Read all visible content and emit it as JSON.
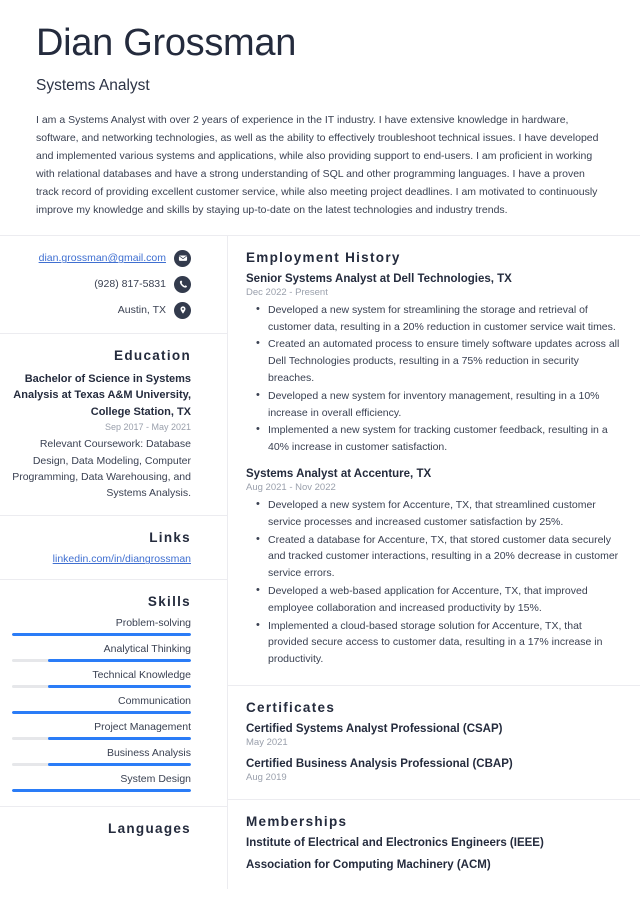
{
  "header": {
    "name": "Dian Grossman",
    "job_title": "Systems Analyst",
    "summary": "I am a Systems Analyst with over 2 years of experience in the IT industry. I have extensive knowledge in hardware, software, and networking technologies, as well as the ability to effectively troubleshoot technical issues. I have developed and implemented various systems and applications, while also providing support to end-users. I am proficient in working with relational databases and have a strong understanding of SQL and other programming languages. I have a proven track record of providing excellent customer service, while also meeting project deadlines. I am motivated to continuously improve my knowledge and skills by staying up-to-date on the latest technologies and industry trends."
  },
  "contact": {
    "email": "dian.grossman@gmail.com",
    "phone": "(928) 817-5831",
    "location": "Austin, TX",
    "email_icon": "envelope-icon",
    "phone_icon": "phone-icon",
    "location_icon": "map-pin-icon"
  },
  "education": {
    "heading": "Education",
    "degree": "Bachelor of Science in Systems Analysis at Texas A&M University, College Station, TX",
    "date": "Sep 2017 - May 2021",
    "description": "Relevant Coursework: Database Design, Data Modeling, Computer Programming, Data Warehousing, and Systems Analysis."
  },
  "links": {
    "heading": "Links",
    "items": [
      {
        "label": "linkedin.com/in/diangrossman"
      }
    ]
  },
  "skills": {
    "heading": "Skills",
    "items": [
      {
        "label": "Problem-solving",
        "level": 100
      },
      {
        "label": "Analytical Thinking",
        "level": 80
      },
      {
        "label": "Technical Knowledge",
        "level": 80
      },
      {
        "label": "Communication",
        "level": 100
      },
      {
        "label": "Project Management",
        "level": 80
      },
      {
        "label": "Business Analysis",
        "level": 80
      },
      {
        "label": "System Design",
        "level": 100
      }
    ]
  },
  "languages": {
    "heading": "Languages"
  },
  "employment": {
    "heading": "Employment History",
    "jobs": [
      {
        "title": "Senior Systems Analyst at Dell Technologies, TX",
        "date": "Dec 2022 - Present",
        "bullets": [
          "Developed a new system for streamlining the storage and retrieval of customer data, resulting in a 20% reduction in customer service wait times.",
          "Created an automated process to ensure timely software updates across all Dell Technologies products, resulting in a 75% reduction in security breaches.",
          "Developed a new system for inventory management, resulting in a 10% increase in overall efficiency.",
          "Implemented a new system for tracking customer feedback, resulting in a 40% increase in customer satisfaction."
        ]
      },
      {
        "title": "Systems Analyst at Accenture, TX",
        "date": "Aug 2021 - Nov 2022",
        "bullets": [
          "Developed a new system for Accenture, TX, that streamlined customer service processes and increased customer satisfaction by 25%.",
          "Created a database for Accenture, TX, that stored customer data securely and tracked customer interactions, resulting in a 20% decrease in customer service errors.",
          "Developed a web-based application for Accenture, TX, that improved employee collaboration and increased productivity by 15%.",
          "Implemented a cloud-based storage solution for Accenture, TX, that provided secure access to customer data, resulting in a 17% increase in productivity."
        ]
      }
    ]
  },
  "certificates": {
    "heading": "Certificates",
    "items": [
      {
        "title": "Certified Systems Analyst Professional (CSAP)",
        "date": "May 2021"
      },
      {
        "title": "Certified Business Analysis Professional (CBAP)",
        "date": "Aug 2019"
      }
    ]
  },
  "memberships": {
    "heading": "Memberships",
    "items": [
      {
        "title": "Institute of Electrical and Electronics Engineers (IEEE)"
      },
      {
        "title": "Association for Computing Machinery (ACM)"
      }
    ]
  },
  "colors": {
    "accent_blue": "#2a7cf7",
    "link_blue": "#3f6fd1",
    "heading_navy": "#242b3d",
    "icon_circle": "#333b4d",
    "muted_gray": "#9aa0ac",
    "divider": "#ececf0"
  }
}
